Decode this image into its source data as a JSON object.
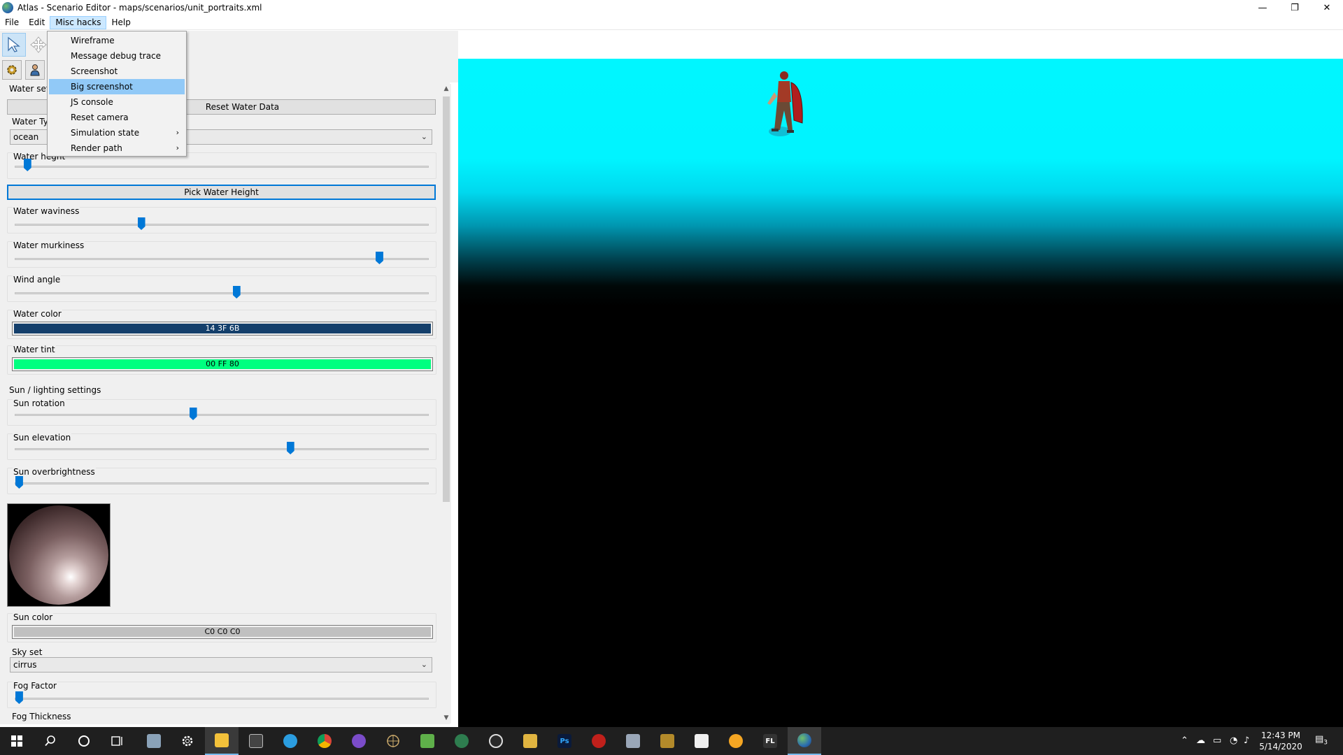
{
  "window": {
    "title": "Atlas - Scenario Editor - maps/scenarios/unit_portraits.xml",
    "minimize": "—",
    "restore": "❐",
    "close": "✕"
  },
  "menubar": {
    "items": [
      "File",
      "Edit",
      "Misc hacks",
      "Help"
    ]
  },
  "misc_menu": {
    "items": [
      {
        "label": "Wireframe"
      },
      {
        "label": "Message debug trace"
      },
      {
        "label": "Screenshot"
      },
      {
        "label": "Big screenshot"
      },
      {
        "label": "JS console"
      },
      {
        "label": "Reset camera"
      },
      {
        "label": "Simulation state"
      },
      {
        "label": "Render path"
      }
    ],
    "highlighted": "Big screenshot",
    "submenu_arrow": "›"
  },
  "water": {
    "section_label_partial": "Water sett",
    "reset_button": "Reset Water Data",
    "type_label_partial": "Water Typ",
    "type_value": "ocean",
    "height_label_partial": "Water he",
    "height_label_tail": "ght",
    "height_value": 0.03,
    "pick_height_button": "Pick Water Height",
    "waviness_label": "Water waviness",
    "waviness_value": 0.305,
    "murkiness_label": "Water murkiness",
    "murkiness_value": 0.88,
    "wind_label": "Wind angle",
    "wind_value": 0.535,
    "color_label": "Water color",
    "color_text": "14 3F 6B",
    "color_hex": "#143f6b",
    "tint_label": "Water tint",
    "tint_text": "00 FF 80",
    "tint_hex": "#00ff80"
  },
  "sun": {
    "section_label": "Sun / lighting settings",
    "rotation_label": "Sun rotation",
    "rotation_value": 0.43,
    "elevation_label": "Sun elevation",
    "elevation_value": 0.665,
    "overbrightness_label": "Sun overbrightness",
    "overbrightness_value": 0.01,
    "color_label": "Sun color",
    "color_text": "C0 C0 C0",
    "color_hex": "#c0c0c0"
  },
  "sky": {
    "label": "Sky set",
    "value": "cirrus"
  },
  "fog": {
    "factor_label": "Fog Factor",
    "factor_value": 0.01,
    "thickness_label": "Fog Thickness"
  },
  "taskbar": {
    "time": "12:43 PM",
    "date": "5/14/2020",
    "notifications": "3",
    "ps_label": "Ps",
    "fl_label": "FL"
  },
  "colors": {
    "accent": "#0078d7",
    "menu_highlight": "#91c9f7",
    "sky_top": "#00f6ff"
  }
}
